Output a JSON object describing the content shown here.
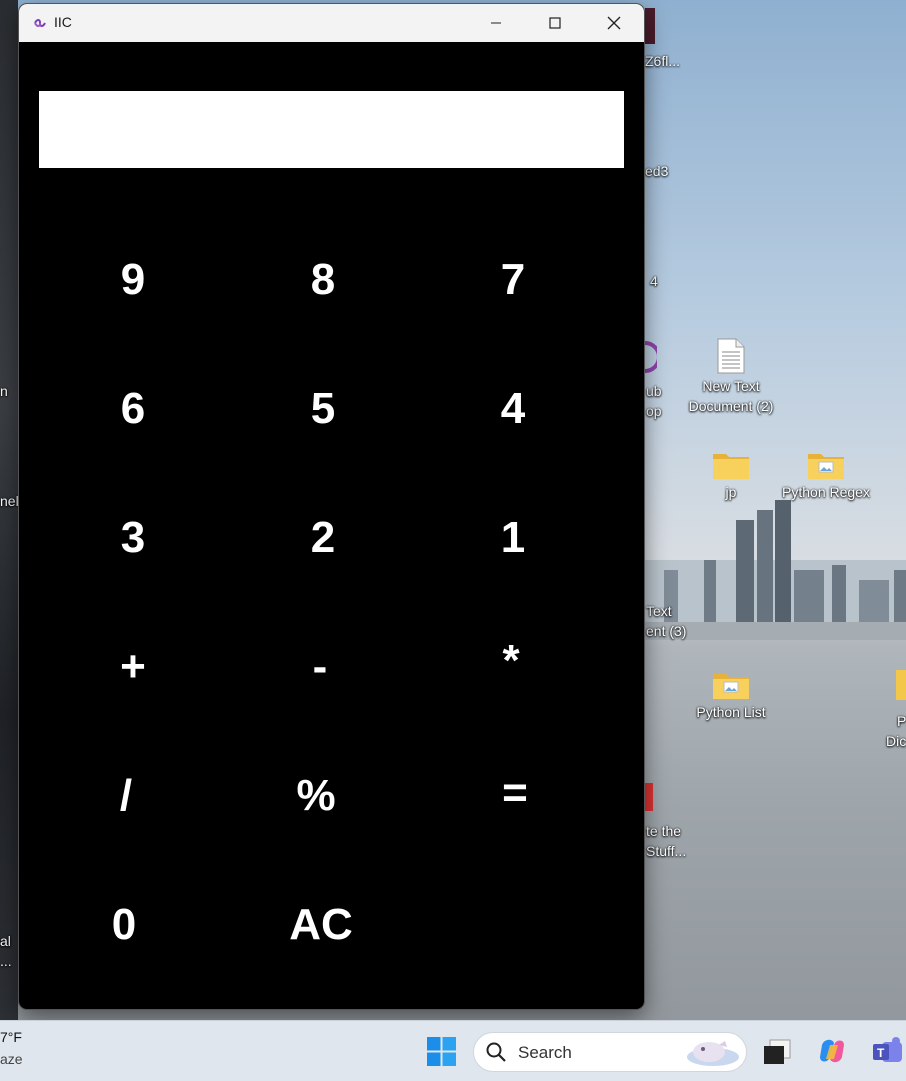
{
  "window": {
    "title": "IIC"
  },
  "display": {
    "value": ""
  },
  "keypad": {
    "keys": [
      "9",
      "8",
      "7",
      "6",
      "5",
      "4",
      "3",
      "2",
      "1",
      "+",
      "-",
      "*",
      "/",
      "%",
      "=",
      "0",
      "AC"
    ]
  },
  "desktop": {
    "icons": [
      {
        "label_line1": "New Text",
        "label_line2": "Document (2)",
        "icon": "text-file-icon"
      },
      {
        "label_line1": "jp",
        "label_line2": "",
        "icon": "folder-icon"
      },
      {
        "label_line1": "Python Regex",
        "label_line2": "",
        "icon": "folder-image-icon"
      },
      {
        "label_line1": "Python List",
        "label_line2": "",
        "icon": "folder-image-icon"
      }
    ],
    "partial_labels": [
      "Z6fl...",
      "ed3",
      "4",
      "ub",
      "op",
      "Text",
      "ent (3)",
      "te the",
      "Stuff...",
      "P",
      "Dic",
      "n",
      "nel",
      "al",
      "..."
    ]
  },
  "taskbar": {
    "weather_temp": "7°F",
    "weather_desc": "aze",
    "search_placeholder": "Search"
  },
  "colors": {
    "accent": "#0078d4",
    "window_bg": "#000000",
    "key_text": "#ffffff"
  }
}
